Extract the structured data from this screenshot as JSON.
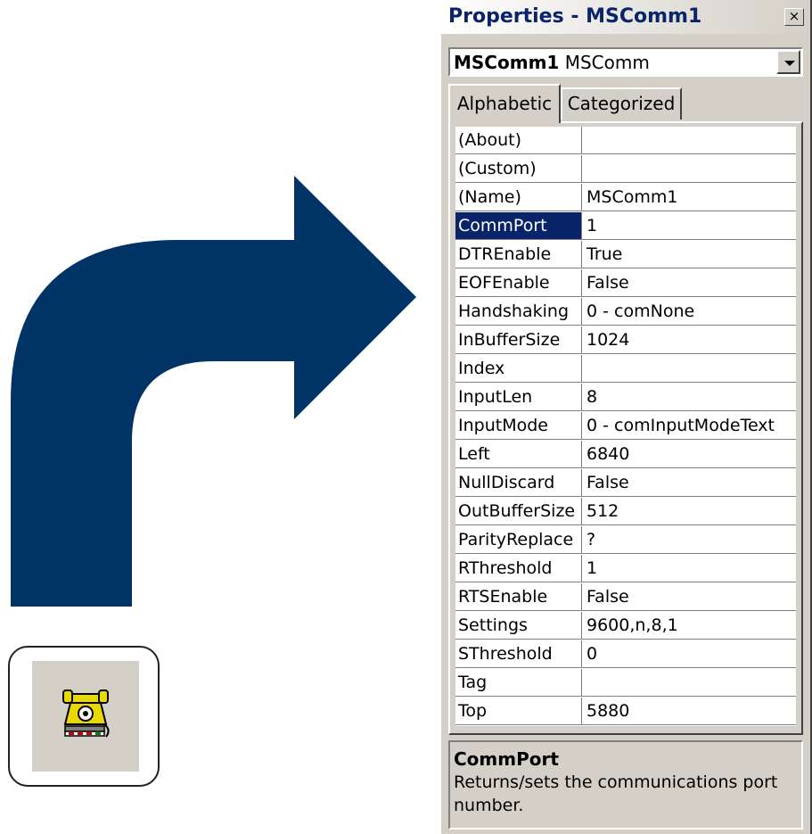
{
  "window": {
    "title": "Properties - MSComm1",
    "close_symbol": "×"
  },
  "object_combo": {
    "name": "MSComm1",
    "type": "MSComm"
  },
  "tabs": [
    "Alphabetic",
    "Categorized"
  ],
  "active_tab": "Alphabetic",
  "properties": [
    {
      "name": "(About)",
      "value": ""
    },
    {
      "name": "(Custom)",
      "value": ""
    },
    {
      "name": "(Name)",
      "value": "MSComm1"
    },
    {
      "name": "CommPort",
      "value": "1"
    },
    {
      "name": "DTREnable",
      "value": "True"
    },
    {
      "name": "EOFEnable",
      "value": "False"
    },
    {
      "name": "Handshaking",
      "value": "0 - comNone"
    },
    {
      "name": "InBufferSize",
      "value": "1024"
    },
    {
      "name": "Index",
      "value": ""
    },
    {
      "name": "InputLen",
      "value": "8"
    },
    {
      "name": "InputMode",
      "value": "0 - comInputModeText"
    },
    {
      "name": "Left",
      "value": "6840"
    },
    {
      "name": "NullDiscard",
      "value": "False"
    },
    {
      "name": "OutBufferSize",
      "value": "512"
    },
    {
      "name": "ParityReplace",
      "value": "?"
    },
    {
      "name": "RThreshold",
      "value": "1"
    },
    {
      "name": "RTSEnable",
      "value": "False"
    },
    {
      "name": "Settings",
      "value": "9600,n,8,1"
    },
    {
      "name": "SThreshold",
      "value": "0"
    },
    {
      "name": "Tag",
      "value": ""
    },
    {
      "name": "Top",
      "value": "5880"
    }
  ],
  "selected_property": "CommPort",
  "description": {
    "title": "CommPort",
    "text": "Returns/sets the communications port number."
  },
  "icons": {
    "arrow": "curved-arrow-icon",
    "toolbox": "telephone-icon"
  },
  "colors": {
    "arrow": "#003366",
    "selection": "#0a246a",
    "panel": "#d4d0c8",
    "title_text": "#0a246a"
  }
}
